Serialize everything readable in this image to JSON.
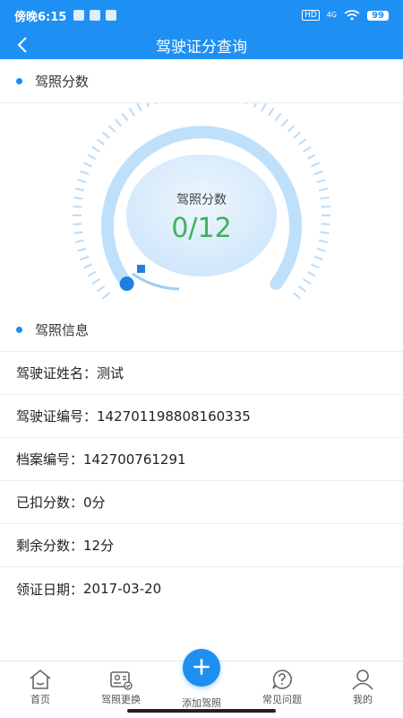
{
  "status_bar": {
    "time": "傍晚6:15",
    "hd": "HD",
    "net": "4G",
    "battery": "99"
  },
  "nav": {
    "title": "驾驶证分查询"
  },
  "score_section": {
    "title": "驾照分数"
  },
  "gauge": {
    "label": "驾照分数",
    "value_text": "0/12",
    "score": 0,
    "max": 12,
    "value_color": "#3cb35a"
  },
  "info_section": {
    "title": "驾照信息"
  },
  "info_rows": [
    {
      "label": "驾驶证姓名：",
      "value": "测试"
    },
    {
      "label": "驾驶证编号：",
      "value": "142701198808160335"
    },
    {
      "label": "档案编号：",
      "value": "142700761291"
    },
    {
      "label": "已扣分数：",
      "value": "0分"
    },
    {
      "label": "剩余分数：",
      "value": "12分"
    },
    {
      "label": "领证日期：",
      "value": "2017-03-20"
    }
  ],
  "tabbar": {
    "items": [
      {
        "label": "首页",
        "icon": "home-icon"
      },
      {
        "label": "驾照更换",
        "icon": "license-change-icon"
      },
      {
        "label": "添加驾照",
        "icon": "add-icon"
      },
      {
        "label": "常见问题",
        "icon": "question-icon"
      },
      {
        "label": "我的",
        "icon": "user-icon"
      }
    ]
  },
  "colors": {
    "primary": "#1e90f3",
    "score_green": "#3cb35a"
  }
}
